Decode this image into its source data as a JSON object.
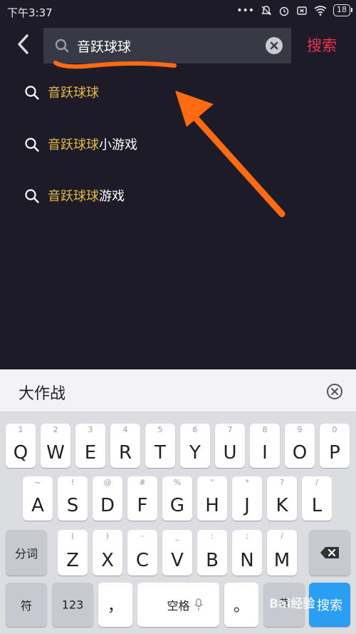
{
  "status_bar": {
    "time": "下午3:37",
    "battery": "18"
  },
  "header": {
    "search_value": "音跃球球",
    "search_button": "搜索"
  },
  "suggestions": [
    {
      "highlight": "音跃球球",
      "rest": ""
    },
    {
      "highlight": "音跃球球",
      "rest": "小游戏"
    },
    {
      "highlight": "音跃球球",
      "rest": "游戏"
    }
  ],
  "keyboard": {
    "candidate": "大作战",
    "row1": [
      {
        "main": "Q",
        "sub": "1"
      },
      {
        "main": "W",
        "sub": "2"
      },
      {
        "main": "E",
        "sub": "3"
      },
      {
        "main": "R",
        "sub": "4"
      },
      {
        "main": "T",
        "sub": "5"
      },
      {
        "main": "Y",
        "sub": "6"
      },
      {
        "main": "U",
        "sub": "7"
      },
      {
        "main": "I",
        "sub": "8"
      },
      {
        "main": "O",
        "sub": "9"
      },
      {
        "main": "P",
        "sub": "0"
      }
    ],
    "row2": [
      {
        "main": "A",
        "sub": "~"
      },
      {
        "main": "S",
        "sub": "!"
      },
      {
        "main": "D",
        "sub": "@"
      },
      {
        "main": "F",
        "sub": "#"
      },
      {
        "main": "G",
        "sub": "%"
      },
      {
        "main": "H",
        "sub": "\""
      },
      {
        "main": "J",
        "sub": "*"
      },
      {
        "main": "K",
        "sub": "?"
      },
      {
        "main": "L",
        "sub": "/"
      }
    ],
    "row3": [
      {
        "main": "Z",
        "sub": "("
      },
      {
        "main": "X",
        "sub": ")"
      },
      {
        "main": "C",
        "sub": "-"
      },
      {
        "main": "V",
        "sub": "_"
      },
      {
        "main": "B",
        "sub": ":"
      },
      {
        "main": "N",
        "sub": ";"
      },
      {
        "main": "M",
        "sub": "/"
      }
    ],
    "segment_label": "分词",
    "symbol_label": "符",
    "num_label": "123",
    "comma_label": "，",
    "space_label": "空格",
    "period_label": "。",
    "lang_label": "英",
    "go_label": "搜索"
  },
  "watermark": "Bai经验",
  "colors": {
    "background": "#1c1b27",
    "highlight": "#e4b84a",
    "search_button": "#f2324e",
    "annotation": "#ff6a13",
    "keyboard_go": "#2a9ef2"
  }
}
